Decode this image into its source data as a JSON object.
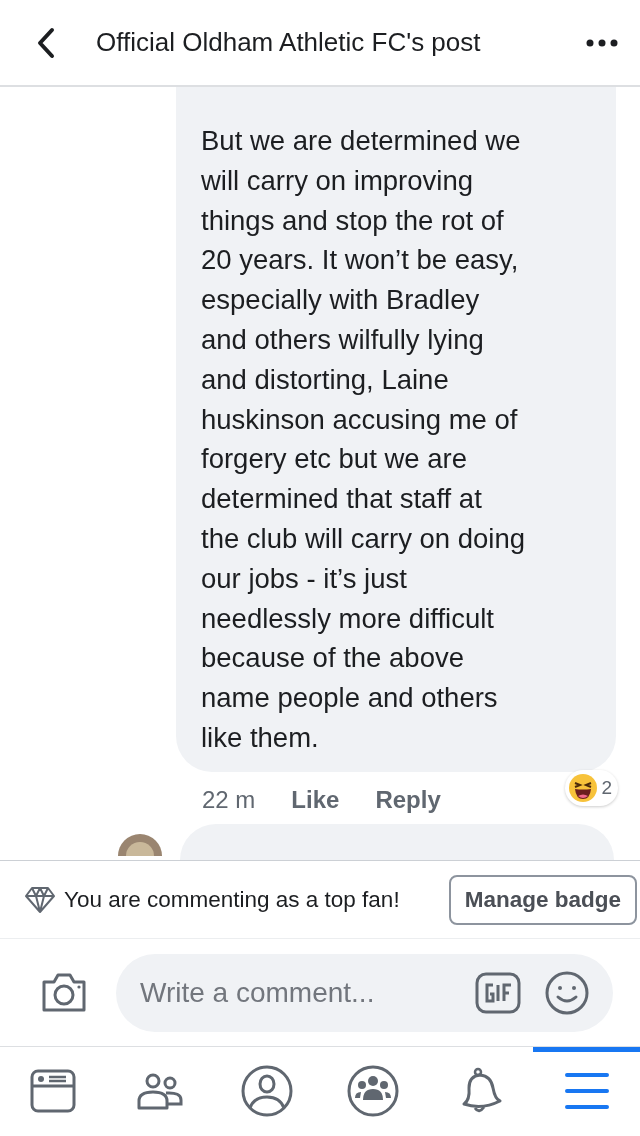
{
  "header": {
    "title": "Official Oldham Athletic FC's post"
  },
  "comment": {
    "text": "But we are determined we\nwill carry on improving\nthings and stop the rot of\n20 years. It won’t be easy,\nespecially with Bradley\nand others wilfully lying\nand distorting, Laine\nhuskinson accusing me of\nforgery etc but we are\ndetermined that staff at\nthe club will carry on doing\nour jobs - it’s just\nneedlessly more difficult\nbecause of the above\nname people and others\nlike them.",
    "time": "22 m",
    "actions": [
      "Like",
      "Reply"
    ],
    "reaction_count": "2"
  },
  "top_fan": {
    "text": "You are commenting as a top fan!",
    "button": "Manage badge"
  },
  "composer": {
    "placeholder": "Write a comment..."
  },
  "tabs": [
    {
      "kind": "news",
      "selected": false
    },
    {
      "kind": "friends",
      "selected": false
    },
    {
      "kind": "profile",
      "selected": false
    },
    {
      "kind": "groups",
      "selected": false
    },
    {
      "kind": "bell",
      "selected": false
    },
    {
      "kind": "menu",
      "selected": true
    }
  ]
}
